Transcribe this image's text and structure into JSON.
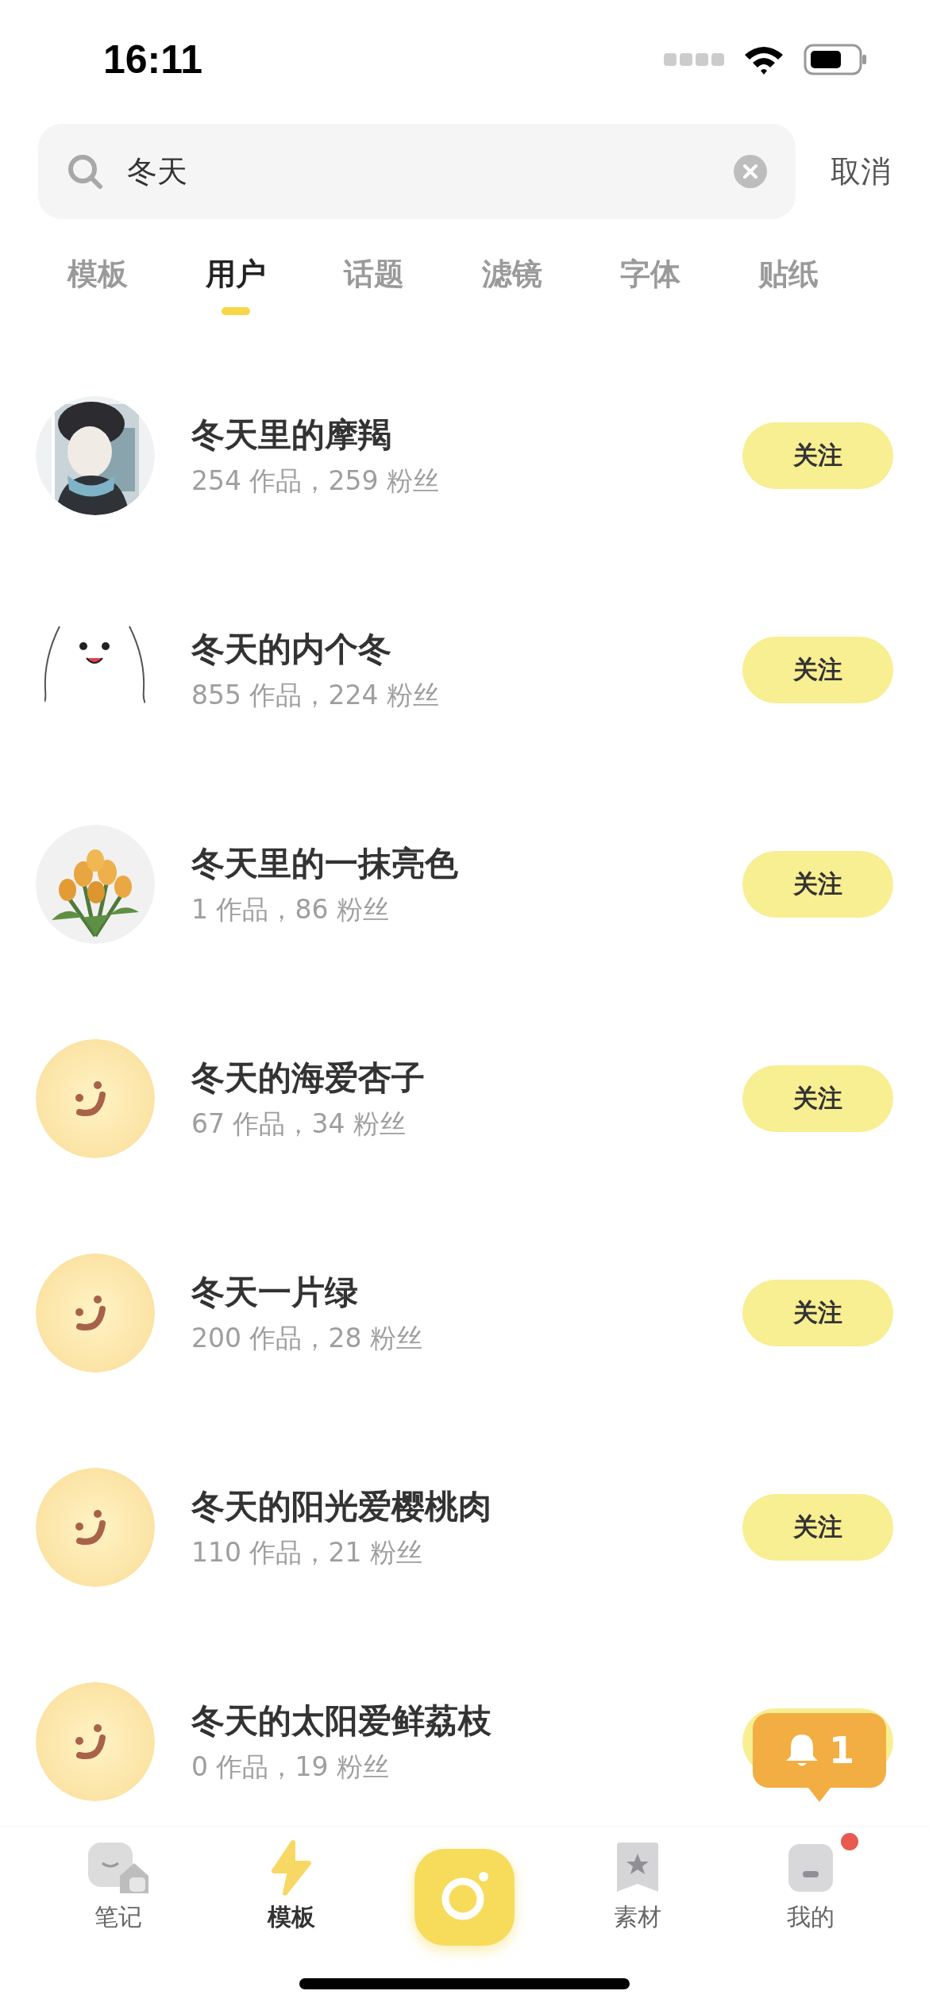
{
  "status_bar": {
    "time": "16:11"
  },
  "search": {
    "value": "冬天",
    "cancel": "取消"
  },
  "tabs": [
    {
      "label": "模板",
      "selected": false
    },
    {
      "label": "用户",
      "selected": true
    },
    {
      "label": "话题",
      "selected": false
    },
    {
      "label": "滤镜",
      "selected": false
    },
    {
      "label": "字体",
      "selected": false
    },
    {
      "label": "贴纸",
      "selected": false
    }
  ],
  "users": [
    {
      "name": "冬天里的摩羯",
      "stats": "254 作品，259 粉丝",
      "button": "关注"
    },
    {
      "avatar": {
        "kind": "snowman"
      },
      "name": "冬天的内个冬",
      "stats": "855 作品，224 粉丝",
      "button": "关注"
    },
    {
      "avatar": {
        "kind": "flowers"
      },
      "name": "冬天里的一抹亮色",
      "stats": "1 作品，86 粉丝",
      "button": "关注"
    },
    {
      "avatar": {
        "kind": "default"
      },
      "name": "冬天的海爱杏子",
      "stats": "67 作品，34 粉丝",
      "button": "关注"
    },
    {
      "avatar": {
        "kind": "default"
      },
      "name": "冬天一片绿",
      "stats": "200 作品，28 粉丝",
      "button": "关注"
    },
    {
      "avatar": {
        "kind": "default"
      },
      "name": "冬天的阳光爱樱桃肉",
      "stats": "110 作品，21 粉丝",
      "button": "关注"
    },
    {
      "avatar": {
        "kind": "default"
      },
      "name": "冬天的太阳爱鲜荔枝",
      "stats": "0 作品，19 粉丝"
    }
  ],
  "notification": {
    "count": "1"
  },
  "nav": [
    {
      "kind": "notes",
      "label": "笔记",
      "selected": false
    },
    {
      "kind": "templates",
      "label": "模板",
      "selected": true
    },
    {
      "kind": "camera"
    },
    {
      "kind": "materials",
      "label": "素材",
      "selected": false
    },
    {
      "kind": "mine",
      "label": "我的",
      "selected": false,
      "badge": true
    }
  ]
}
